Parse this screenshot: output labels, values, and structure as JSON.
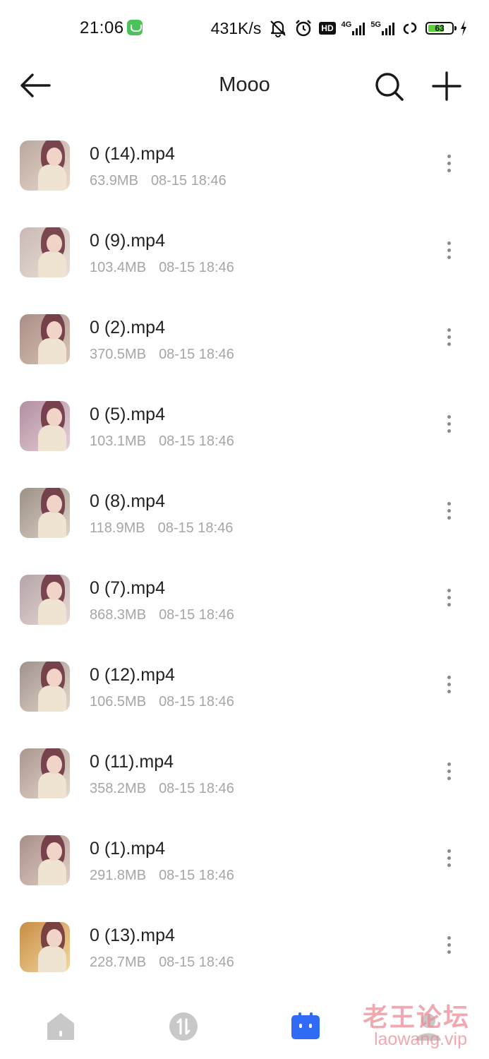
{
  "status_bar": {
    "time": "21:06",
    "net_speed": "431K/s",
    "hd_badge": "HD",
    "net_4g": "4G",
    "net_5g": "5G",
    "battery": "63",
    "icons": [
      "wechat-icon",
      "mute-icon",
      "alarm-icon",
      "signal-icon",
      "link-icon",
      "battery-icon",
      "charging-icon"
    ]
  },
  "header": {
    "title": "Mooo",
    "back_icon": "arrow-left-icon",
    "search_icon": "search-icon",
    "add_icon": "plus-icon"
  },
  "files": [
    {
      "name": "0 (14).mp4",
      "size": "63.9MB",
      "date": "08-15 18:46"
    },
    {
      "name": "0 (9).mp4",
      "size": "103.4MB",
      "date": "08-15 18:46"
    },
    {
      "name": "0 (2).mp4",
      "size": "370.5MB",
      "date": "08-15 18:46"
    },
    {
      "name": "0 (5).mp4",
      "size": "103.1MB",
      "date": "08-15 18:46"
    },
    {
      "name": "0 (8).mp4",
      "size": "118.9MB",
      "date": "08-15 18:46"
    },
    {
      "name": "0 (7).mp4",
      "size": "868.3MB",
      "date": "08-15 18:46"
    },
    {
      "name": "0 (12).mp4",
      "size": "106.5MB",
      "date": "08-15 18:46"
    },
    {
      "name": "0 (11).mp4",
      "size": "358.2MB",
      "date": "08-15 18:46"
    },
    {
      "name": "0 (1).mp4",
      "size": "291.8MB",
      "date": "08-15 18:46"
    },
    {
      "name": "0 (13).mp4",
      "size": "228.7MB",
      "date": "08-15 18:46"
    }
  ],
  "bottom_nav": {
    "items": [
      "home-icon",
      "transfer-icon",
      "files-box-icon",
      "profile-icon"
    ],
    "active": "files-box-icon",
    "active_color": "#2f6bf5",
    "inactive_color": "#c8c8c8"
  },
  "watermark": {
    "text_cn": "老王论坛",
    "text_en": "laowang.vip"
  }
}
